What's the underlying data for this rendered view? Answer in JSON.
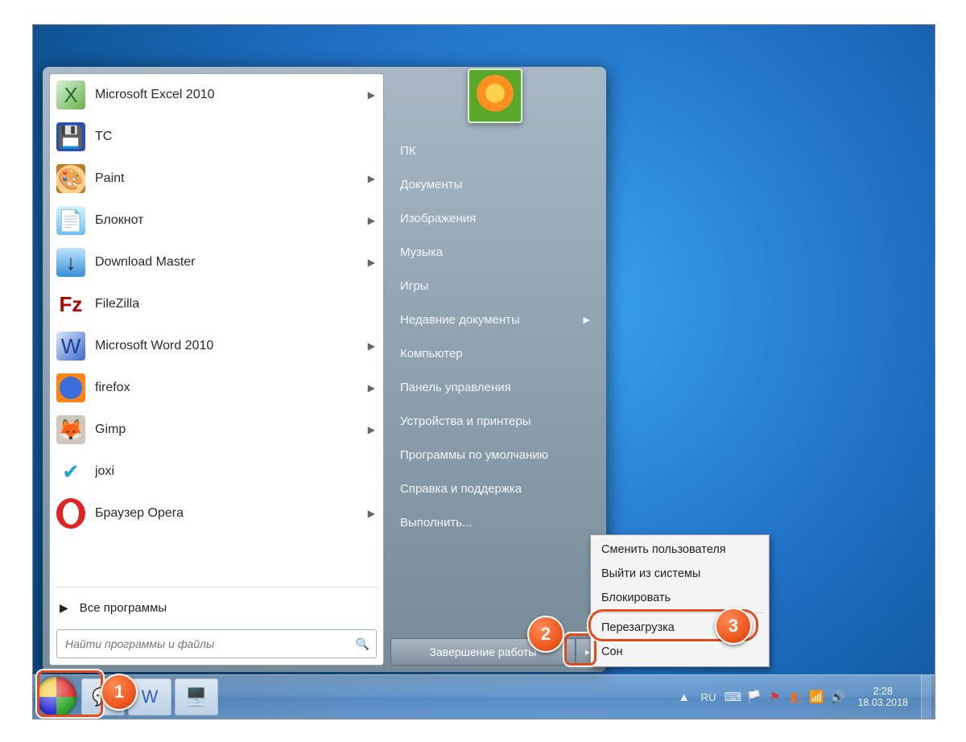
{
  "programs": [
    {
      "label": "Microsoft Excel 2010",
      "icon": "ico-excel",
      "glyph": "X",
      "submenu": true
    },
    {
      "label": "TC",
      "icon": "ico-tc",
      "glyph": "💾",
      "submenu": false
    },
    {
      "label": "Paint",
      "icon": "ico-paint",
      "glyph": "🎨",
      "submenu": true
    },
    {
      "label": "Блокнот",
      "icon": "ico-note",
      "glyph": "📄",
      "submenu": true
    },
    {
      "label": "Download Master",
      "icon": "ico-dm",
      "glyph": "↓",
      "submenu": true
    },
    {
      "label": "FileZilla",
      "icon": "ico-fz",
      "glyph": "Fz",
      "submenu": false
    },
    {
      "label": "Microsoft Word 2010",
      "icon": "ico-word",
      "glyph": "W",
      "submenu": true
    },
    {
      "label": "firefox",
      "icon": "ico-ff",
      "glyph": "",
      "submenu": true
    },
    {
      "label": "Gimp",
      "icon": "ico-gimp",
      "glyph": "🦊",
      "submenu": true
    },
    {
      "label": "joxi",
      "icon": "ico-joxi",
      "glyph": "✔",
      "submenu": false
    },
    {
      "label": "Браузер Opera",
      "icon": "ico-opera",
      "glyph": "",
      "submenu": true
    }
  ],
  "all_programs": "Все программы",
  "search_placeholder": "Найти программы и файлы",
  "right_links": [
    {
      "label": "ПК",
      "submenu": false
    },
    {
      "label": "Документы",
      "submenu": false
    },
    {
      "label": "Изображения",
      "submenu": false
    },
    {
      "label": "Музыка",
      "submenu": false
    },
    {
      "label": "Игры",
      "submenu": false
    },
    {
      "label": "Недавние документы",
      "submenu": true
    },
    {
      "label": "Компьютер",
      "submenu": false
    },
    {
      "label": "Панель управления",
      "submenu": false
    },
    {
      "label": "Устройства и принтеры",
      "submenu": false
    },
    {
      "label": "Программы по умолчанию",
      "submenu": false
    },
    {
      "label": "Справка и поддержка",
      "submenu": false
    },
    {
      "label": "Выполнить...",
      "submenu": false
    }
  ],
  "shutdown_label": "Завершение работы",
  "shutdown_menu": [
    "Сменить пользователя",
    "Выйти из системы",
    "Блокировать",
    "__sep__",
    "Перезагрузка",
    "Сон"
  ],
  "tray": {
    "lang": "RU",
    "time": "2:28",
    "date": "18.03.2018"
  },
  "callouts": {
    "b1": "1",
    "b2": "2",
    "b3": "3"
  }
}
